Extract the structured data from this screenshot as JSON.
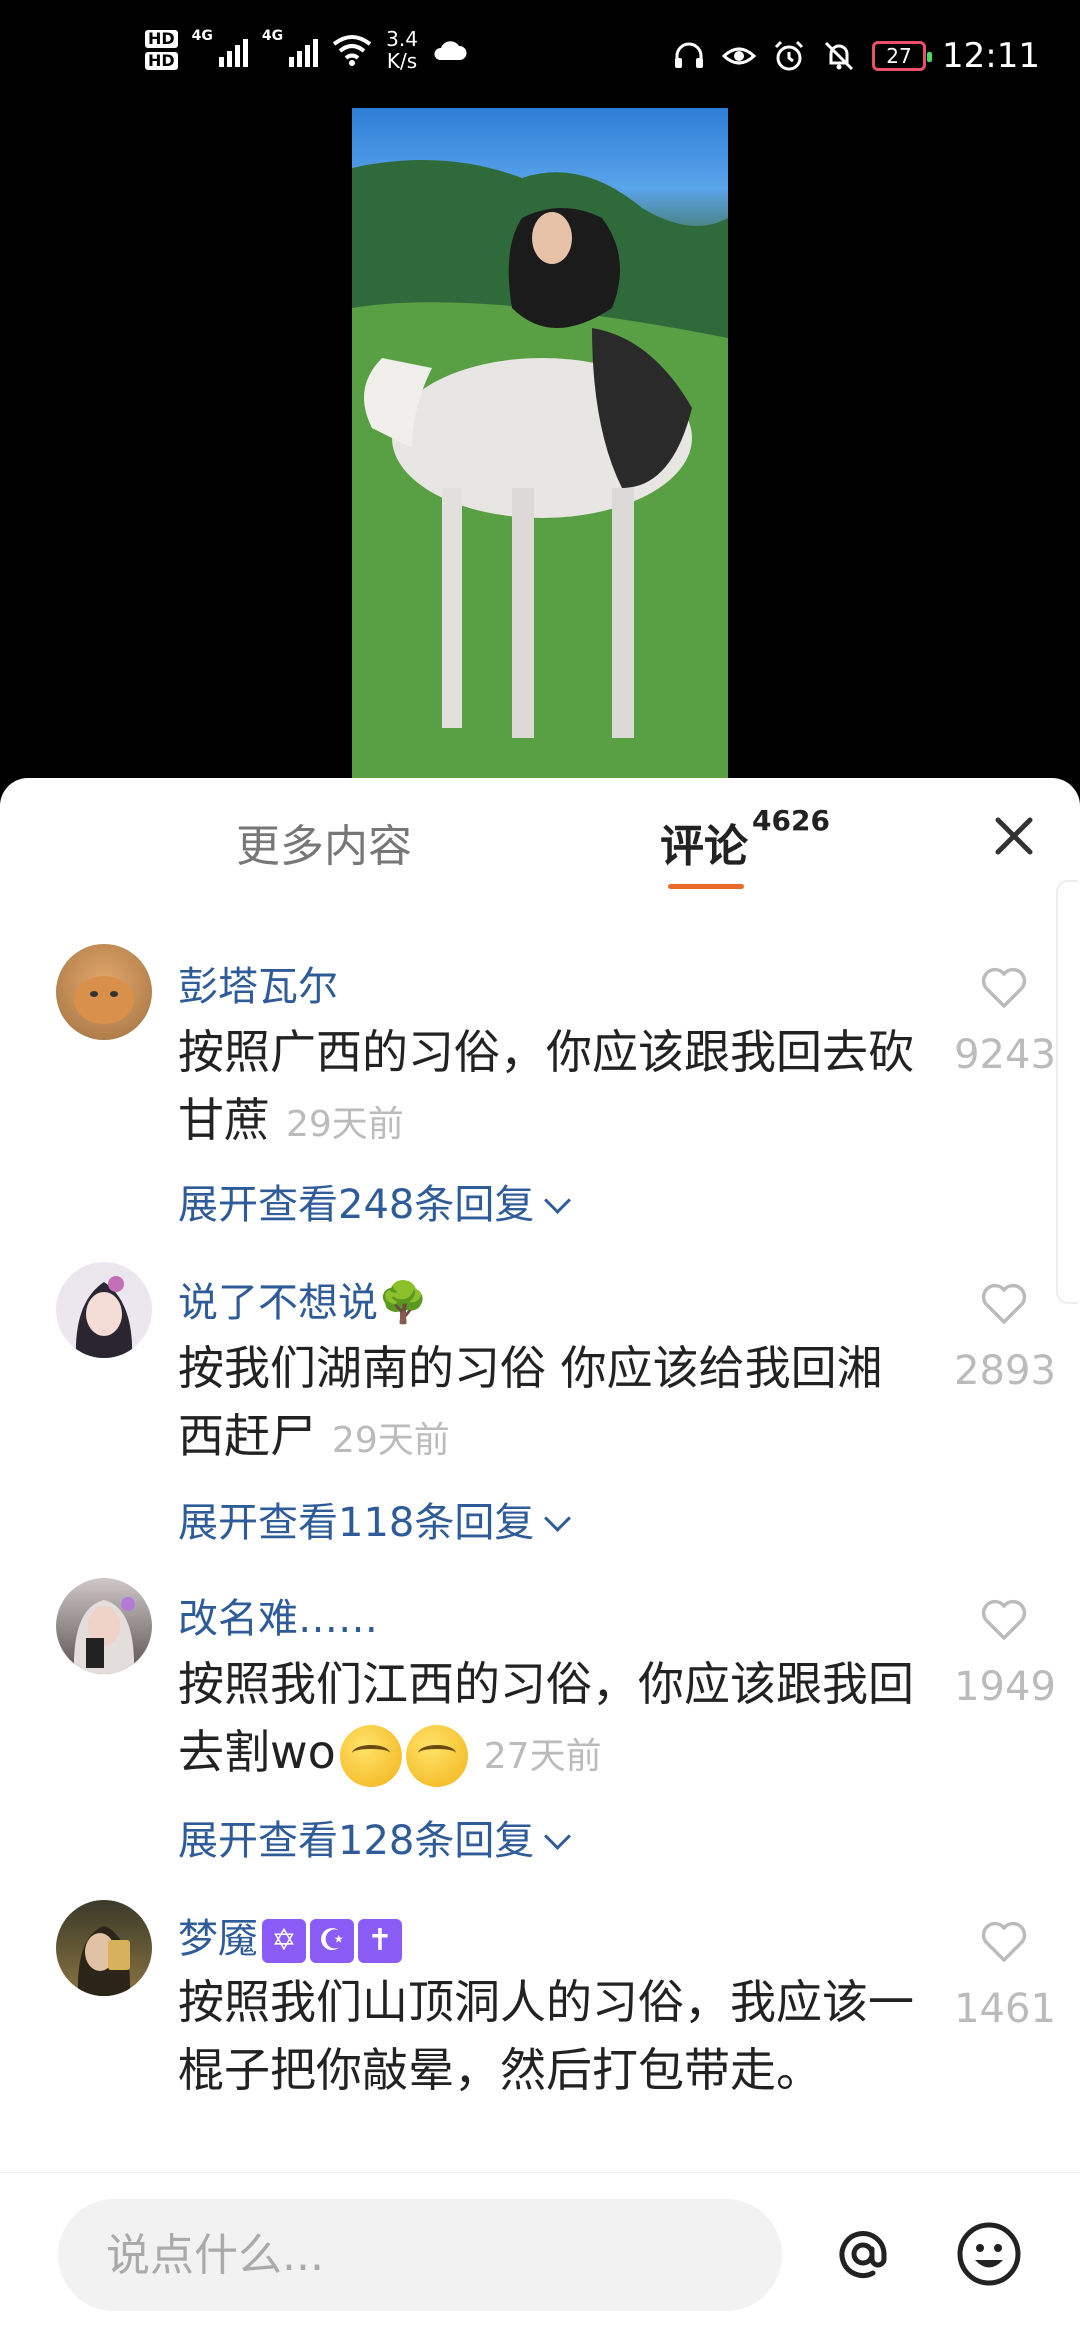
{
  "status_bar": {
    "hd1": "HD",
    "hd2": "HD",
    "net1": "4G",
    "net2": "4G",
    "speed_value": "3.4",
    "speed_unit": "K/s",
    "battery": "27",
    "time": "12:11"
  },
  "tabs": {
    "more_label": "更多内容",
    "comments_label": "评论",
    "comments_count": "4626"
  },
  "comments": [
    {
      "name": "彭塔瓦尔",
      "text": "按照广西的习俗，你应该跟我回去砍甘蔗",
      "time": "29天前",
      "expand": "展开查看248条回复",
      "likes": "9243"
    },
    {
      "name": "说了不想说🌳",
      "text": "按我们湖南的习俗 你应该给我回湘西赶尸",
      "time": "29天前",
      "expand": "展开查看118条回复",
      "likes": "2893"
    },
    {
      "name": "改名难……",
      "text": "按照我们江西的习俗，你应该跟我回去割wo",
      "time": "27天前",
      "expand": "展开查看128条回复",
      "likes": "1949"
    },
    {
      "name": "梦魇",
      "badges": [
        "✡",
        "☪",
        "✝"
      ],
      "text": "按照我们山顶洞人的习俗，我应该一棍子把你敲晕，然后打包带走。",
      "likes": "1461"
    }
  ],
  "input": {
    "placeholder": "说点什么..."
  },
  "colors": {
    "accent": "#ea6a2c",
    "link": "#2f5c99",
    "muted": "#bbbbbb"
  }
}
